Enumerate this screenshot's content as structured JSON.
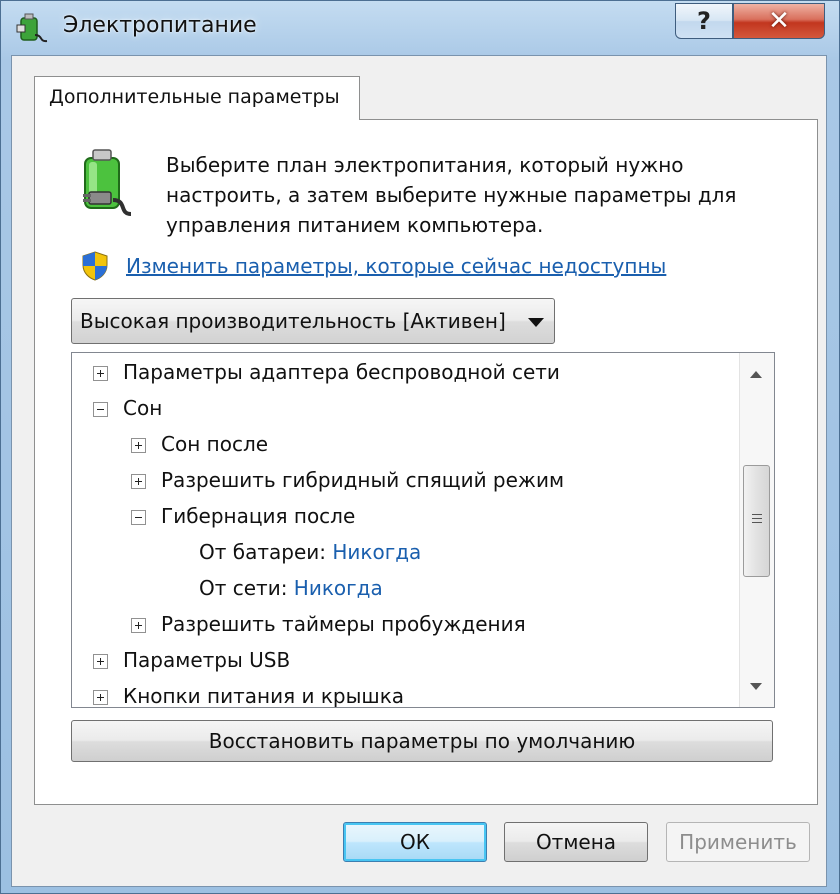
{
  "window": {
    "title": "Электропитание",
    "help_label": "?",
    "close_label": "✕"
  },
  "tab": {
    "label": "Дополнительные параметры"
  },
  "description": {
    "line1": "Выберите план электропитания, который нужно",
    "line2": "настроить, а затем выберите нужные параметры для",
    "line3": "управления питанием компьютера."
  },
  "change_link": "Изменить параметры, которые сейчас недоступны",
  "plan_select": {
    "value": "Высокая производительность [Активен]"
  },
  "tree": {
    "items": [
      {
        "label": "Параметры адаптера беспроводной сети",
        "expander": "plus"
      },
      {
        "label": "Сон",
        "expander": "minus"
      },
      {
        "label": "Сон после",
        "expander": "plus"
      },
      {
        "label": "Разрешить гибридный спящий режим",
        "expander": "plus"
      },
      {
        "label": "Гибернация после",
        "expander": "minus"
      },
      {
        "label": "От батареи:",
        "value": "Никогда"
      },
      {
        "label": "От сети:",
        "value": "Никогда"
      },
      {
        "label": "Разрешить таймеры пробуждения",
        "expander": "plus"
      },
      {
        "label": "Параметры USB",
        "expander": "plus"
      },
      {
        "label": "Кнопки питания и крышка",
        "expander": "plus"
      }
    ]
  },
  "restore_button": "Восстановить параметры по умолчанию",
  "buttons": {
    "ok": "ОК",
    "cancel": "Отмена",
    "apply": "Применить"
  },
  "icons": {
    "app": "power-plug-icon",
    "battery": "battery-plug-icon",
    "shield": "uac-shield-icon",
    "dropdown": "chevron-down-icon"
  },
  "colors": {
    "link": "#1a5fae",
    "close_button": "#c2361f",
    "ok_focus": "#48c5f2"
  }
}
